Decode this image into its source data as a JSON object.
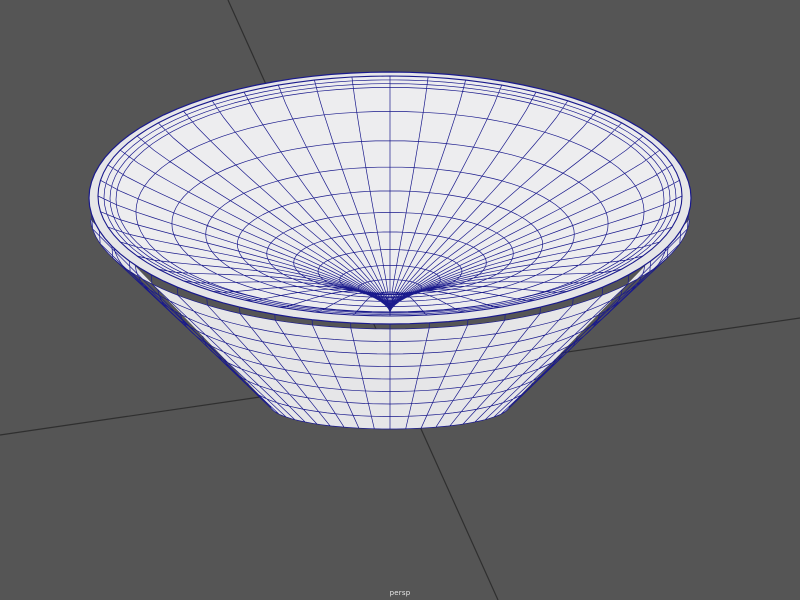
{
  "viewport": {
    "camera_label": "persp",
    "object_icon": "bowl-mesh-icon",
    "colors": {
      "background": "#555555",
      "grid_line": "#2e2e2e",
      "mesh_fill": "#e6e6e8",
      "mesh_fill_inner": "#ededef",
      "wireframe": "#1a1a8c"
    }
  }
}
